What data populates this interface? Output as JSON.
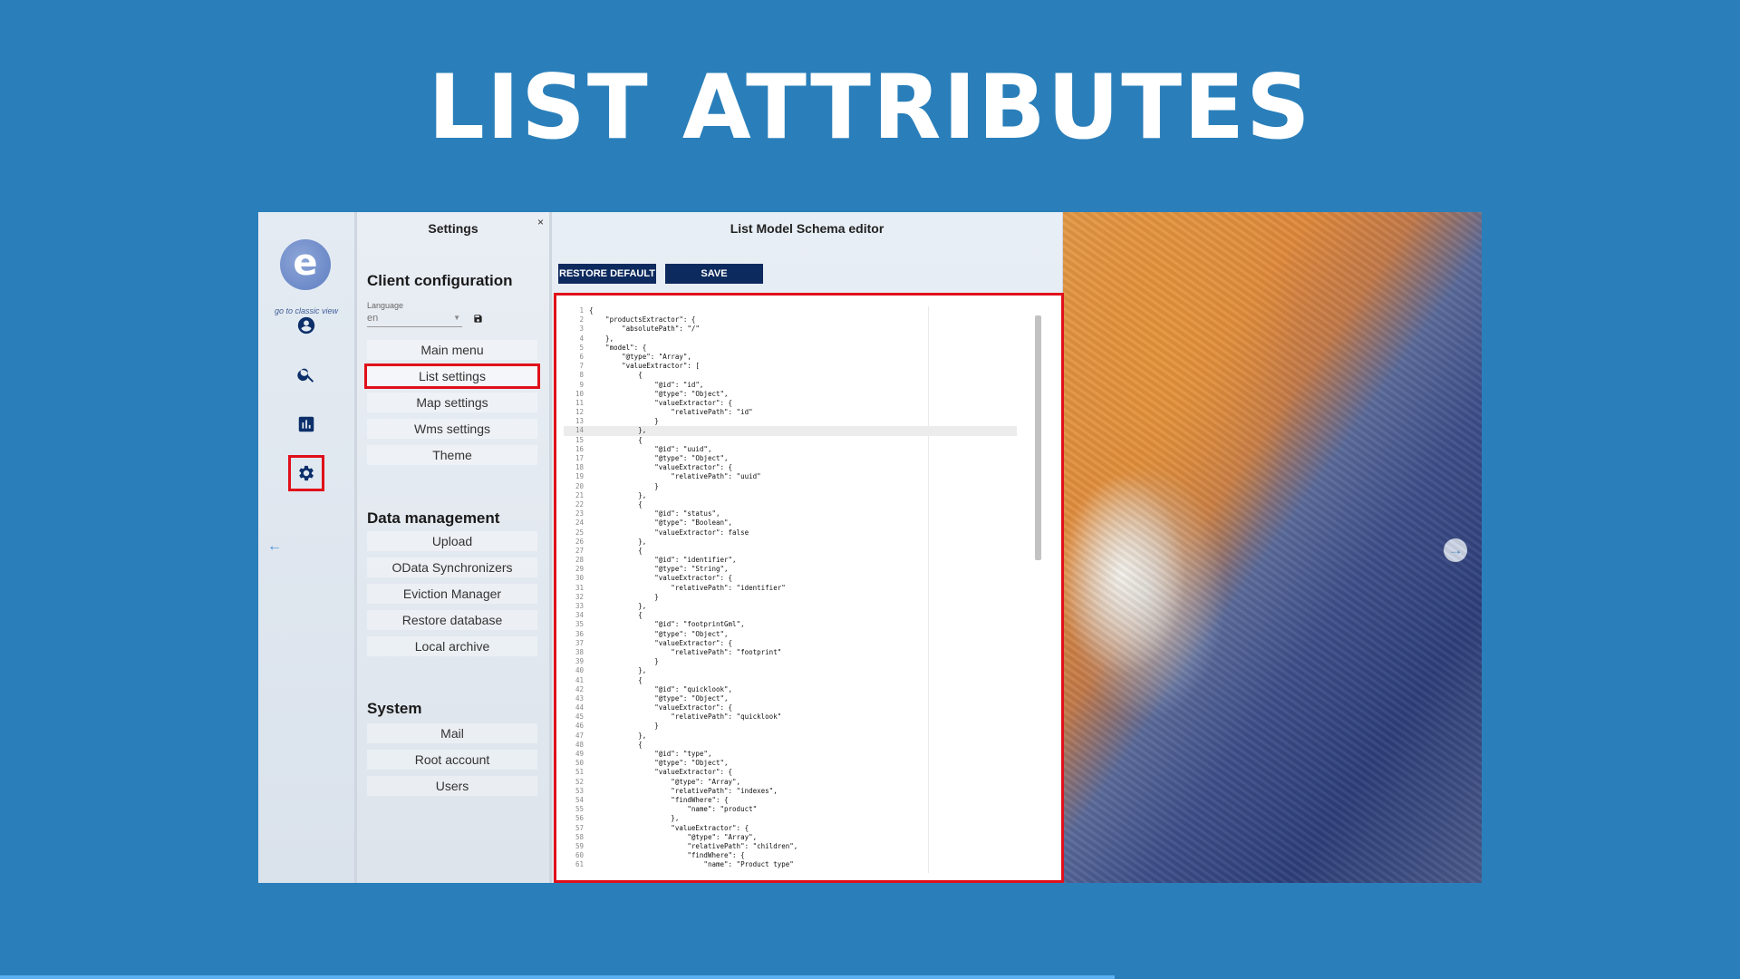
{
  "slide": {
    "title": "LIST ATTRIBUTES"
  },
  "rail": {
    "logo_text": "e",
    "classic_link": "go to classic view",
    "buttons": [
      {
        "name": "account-circle-icon",
        "selected": false
      },
      {
        "name": "search-icon",
        "selected": false
      },
      {
        "name": "bar-chart-icon",
        "selected": false
      },
      {
        "name": "gear-icon",
        "selected": true
      }
    ],
    "back_icon": "←"
  },
  "settings": {
    "title": "Settings",
    "close": "×",
    "client_configuration": {
      "title": "Client configuration",
      "language_label": "Language",
      "language_value": "en",
      "items": [
        "Main menu",
        "List settings",
        "Map settings",
        "Wms settings",
        "Theme"
      ],
      "active_item": "List settings"
    },
    "data_management": {
      "title": "Data management",
      "items": [
        "Upload",
        "OData Synchronizers",
        "Eviction Manager",
        "Restore database",
        "Local archive"
      ]
    },
    "system": {
      "title": "System",
      "items": [
        "Mail",
        "Root account",
        "Users"
      ]
    }
  },
  "editor": {
    "title": "List Model Schema editor",
    "restore_label": "RESTORE DEFAULT",
    "save_label": "SAVE",
    "highlighted_line": 14,
    "lines": [
      "{",
      "    \"productsExtractor\": {",
      "        \"absolutePath\": \"/\"",
      "    },",
      "    \"model\": {",
      "        \"@type\": \"Array\",",
      "        \"valueExtractor\": [",
      "            {",
      "                \"@id\": \"id\",",
      "                \"@type\": \"Object\",",
      "                \"valueExtractor\": {",
      "                    \"relativePath\": \"id\"",
      "                }",
      "            },",
      "            {",
      "                \"@id\": \"uuid\",",
      "                \"@type\": \"Object\",",
      "                \"valueExtractor\": {",
      "                    \"relativePath\": \"uuid\"",
      "                }",
      "            },",
      "            {",
      "                \"@id\": \"status\",",
      "                \"@type\": \"Boolean\",",
      "                \"valueExtractor\": false",
      "            },",
      "            {",
      "                \"@id\": \"identifier\",",
      "                \"@type\": \"String\",",
      "                \"valueExtractor\": {",
      "                    \"relativePath\": \"identifier\"",
      "                }",
      "            },",
      "            {",
      "                \"@id\": \"footprintGml\",",
      "                \"@type\": \"Object\",",
      "                \"valueExtractor\": {",
      "                    \"relativePath\": \"footprint\"",
      "                }",
      "            },",
      "            {",
      "                \"@id\": \"quicklook\",",
      "                \"@type\": \"Object\",",
      "                \"valueExtractor\": {",
      "                    \"relativePath\": \"quicklook\"",
      "                }",
      "            },",
      "            {",
      "                \"@id\": \"type\",",
      "                \"@type\": \"Object\",",
      "                \"valueExtractor\": {",
      "                    \"@type\": \"Array\",",
      "                    \"relativePath\": \"indexes\",",
      "                    \"findWhere\": {",
      "                        \"name\": \"product\"",
      "                    },",
      "                    \"valueExtractor\": {",
      "                        \"@type\": \"Array\",",
      "                        \"relativePath\": \"children\",",
      "                        \"findWhere\": {",
      "                            \"name\": \"Product type\""
    ]
  },
  "map": {
    "next_icon": "→"
  },
  "colors": {
    "slide_bg": "#2a7fba",
    "highlight": "#e0101a",
    "button_bg": "#0d2a5e"
  }
}
